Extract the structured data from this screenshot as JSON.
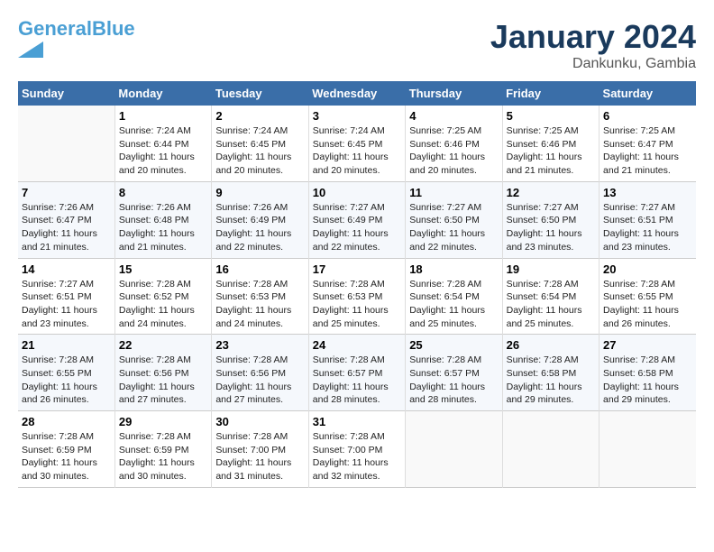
{
  "header": {
    "logo_line1": "General",
    "logo_line1_accent": "Blue",
    "month": "January 2024",
    "location": "Dankunku, Gambia"
  },
  "weekdays": [
    "Sunday",
    "Monday",
    "Tuesday",
    "Wednesday",
    "Thursday",
    "Friday",
    "Saturday"
  ],
  "weeks": [
    [
      {
        "day": "",
        "text": ""
      },
      {
        "day": "1",
        "text": "Sunrise: 7:24 AM\nSunset: 6:44 PM\nDaylight: 11 hours\nand 20 minutes."
      },
      {
        "day": "2",
        "text": "Sunrise: 7:24 AM\nSunset: 6:45 PM\nDaylight: 11 hours\nand 20 minutes."
      },
      {
        "day": "3",
        "text": "Sunrise: 7:24 AM\nSunset: 6:45 PM\nDaylight: 11 hours\nand 20 minutes."
      },
      {
        "day": "4",
        "text": "Sunrise: 7:25 AM\nSunset: 6:46 PM\nDaylight: 11 hours\nand 20 minutes."
      },
      {
        "day": "5",
        "text": "Sunrise: 7:25 AM\nSunset: 6:46 PM\nDaylight: 11 hours\nand 21 minutes."
      },
      {
        "day": "6",
        "text": "Sunrise: 7:25 AM\nSunset: 6:47 PM\nDaylight: 11 hours\nand 21 minutes."
      }
    ],
    [
      {
        "day": "7",
        "text": "Sunrise: 7:26 AM\nSunset: 6:47 PM\nDaylight: 11 hours\nand 21 minutes."
      },
      {
        "day": "8",
        "text": "Sunrise: 7:26 AM\nSunset: 6:48 PM\nDaylight: 11 hours\nand 21 minutes."
      },
      {
        "day": "9",
        "text": "Sunrise: 7:26 AM\nSunset: 6:49 PM\nDaylight: 11 hours\nand 22 minutes."
      },
      {
        "day": "10",
        "text": "Sunrise: 7:27 AM\nSunset: 6:49 PM\nDaylight: 11 hours\nand 22 minutes."
      },
      {
        "day": "11",
        "text": "Sunrise: 7:27 AM\nSunset: 6:50 PM\nDaylight: 11 hours\nand 22 minutes."
      },
      {
        "day": "12",
        "text": "Sunrise: 7:27 AM\nSunset: 6:50 PM\nDaylight: 11 hours\nand 23 minutes."
      },
      {
        "day": "13",
        "text": "Sunrise: 7:27 AM\nSunset: 6:51 PM\nDaylight: 11 hours\nand 23 minutes."
      }
    ],
    [
      {
        "day": "14",
        "text": "Sunrise: 7:27 AM\nSunset: 6:51 PM\nDaylight: 11 hours\nand 23 minutes."
      },
      {
        "day": "15",
        "text": "Sunrise: 7:28 AM\nSunset: 6:52 PM\nDaylight: 11 hours\nand 24 minutes."
      },
      {
        "day": "16",
        "text": "Sunrise: 7:28 AM\nSunset: 6:53 PM\nDaylight: 11 hours\nand 24 minutes."
      },
      {
        "day": "17",
        "text": "Sunrise: 7:28 AM\nSunset: 6:53 PM\nDaylight: 11 hours\nand 25 minutes."
      },
      {
        "day": "18",
        "text": "Sunrise: 7:28 AM\nSunset: 6:54 PM\nDaylight: 11 hours\nand 25 minutes."
      },
      {
        "day": "19",
        "text": "Sunrise: 7:28 AM\nSunset: 6:54 PM\nDaylight: 11 hours\nand 25 minutes."
      },
      {
        "day": "20",
        "text": "Sunrise: 7:28 AM\nSunset: 6:55 PM\nDaylight: 11 hours\nand 26 minutes."
      }
    ],
    [
      {
        "day": "21",
        "text": "Sunrise: 7:28 AM\nSunset: 6:55 PM\nDaylight: 11 hours\nand 26 minutes."
      },
      {
        "day": "22",
        "text": "Sunrise: 7:28 AM\nSunset: 6:56 PM\nDaylight: 11 hours\nand 27 minutes."
      },
      {
        "day": "23",
        "text": "Sunrise: 7:28 AM\nSunset: 6:56 PM\nDaylight: 11 hours\nand 27 minutes."
      },
      {
        "day": "24",
        "text": "Sunrise: 7:28 AM\nSunset: 6:57 PM\nDaylight: 11 hours\nand 28 minutes."
      },
      {
        "day": "25",
        "text": "Sunrise: 7:28 AM\nSunset: 6:57 PM\nDaylight: 11 hours\nand 28 minutes."
      },
      {
        "day": "26",
        "text": "Sunrise: 7:28 AM\nSunset: 6:58 PM\nDaylight: 11 hours\nand 29 minutes."
      },
      {
        "day": "27",
        "text": "Sunrise: 7:28 AM\nSunset: 6:58 PM\nDaylight: 11 hours\nand 29 minutes."
      }
    ],
    [
      {
        "day": "28",
        "text": "Sunrise: 7:28 AM\nSunset: 6:59 PM\nDaylight: 11 hours\nand 30 minutes."
      },
      {
        "day": "29",
        "text": "Sunrise: 7:28 AM\nSunset: 6:59 PM\nDaylight: 11 hours\nand 30 minutes."
      },
      {
        "day": "30",
        "text": "Sunrise: 7:28 AM\nSunset: 7:00 PM\nDaylight: 11 hours\nand 31 minutes."
      },
      {
        "day": "31",
        "text": "Sunrise: 7:28 AM\nSunset: 7:00 PM\nDaylight: 11 hours\nand 32 minutes."
      },
      {
        "day": "",
        "text": ""
      },
      {
        "day": "",
        "text": ""
      },
      {
        "day": "",
        "text": ""
      }
    ]
  ]
}
